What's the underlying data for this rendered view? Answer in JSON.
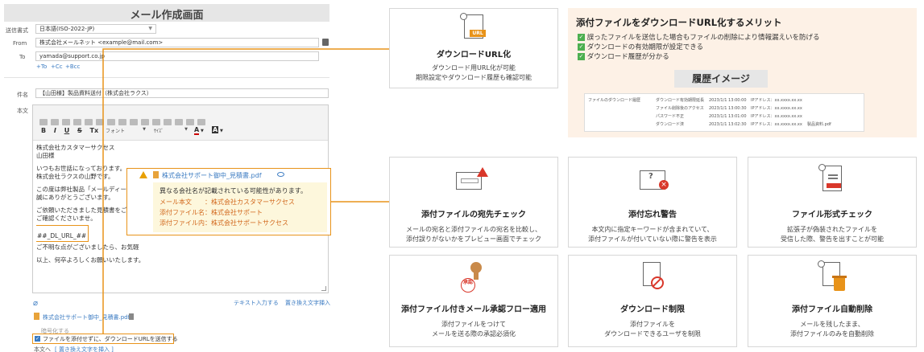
{
  "compose": {
    "title": "メール作成画面",
    "fields": {
      "encoding_label": "送信書式",
      "encoding_value": "日本語(ISO-2022-JP)",
      "from_label": "From",
      "from_value": "株式会社メールネット <example@mail.com>",
      "to_label": "To",
      "to_value": "yamada@support.co.jp",
      "to_links": [
        "+To",
        "+Cc",
        "+Bcc"
      ],
      "subject_label": "件名",
      "subject_value": "【山田様】製品資料送付（株式会社ラクス）",
      "body_label": "本文"
    },
    "toolbar": {
      "font_label": "フォント",
      "size_label": "ｻｲｽﾞ",
      "format_buttons": [
        "B",
        "I",
        "U",
        "S",
        "Tx"
      ],
      "color_a": "A",
      "color_b": "A"
    },
    "body_lines": [
      "株式会社カスタマーサクセス",
      "山田様",
      "",
      "いつもお世話になっております。",
      "株式会社ラクスの山野です。",
      "",
      "この度は弊社製品「メールディーラー",
      "誠にありがとうございます。",
      "",
      "ご依頼いただきました見積書をご案",
      "ご確認くださいませ。"
    ],
    "placeholder_tag": "##_DL_URL_##",
    "body_lines_after": [
      "ご不明な点がございましたら、お気軽",
      "",
      "以上、何卒よろしくお願いいたします。"
    ],
    "footer_links": [
      "テキスト入力する",
      "置き換え文字挿入"
    ],
    "attachment_name": "株式会社サポート御中_見積書.pdf",
    "encrypt_label": "暗号化する",
    "checkbox_label": "ファイルを添付せずに、ダウンロードURLを送信する",
    "insert_prefix": "本文へ",
    "insert_link": "[ 置き換え文字を挿入 ]"
  },
  "warning_popup": {
    "filename": "株式会社サポート御中_見積書.pdf",
    "message": "異なる会社名が記載されている可能性があります。",
    "rows": [
      {
        "key": "メール本文",
        "value": "：株式会社カスタマーサクセス"
      },
      {
        "key": "添付ファイル名",
        "value": "：株式会社サポート"
      },
      {
        "key": "添付ファイル内",
        "value": "：株式会社サポートサクセス"
      }
    ]
  },
  "features": {
    "download_url": {
      "title": "ダウンロードURL化",
      "desc": [
        "ダウンロード用URL化が可能",
        "期限設定やダウンロード履歴も確認可能"
      ],
      "icon_badge": "URL"
    },
    "merits": {
      "title": "添付ファイルをダウンロードURL化するメリット",
      "items": [
        "誤ったファイルを送信した場合もファイルの削除により情報漏えいを防げる",
        "ダウンロードの有効期限が設定できる",
        "ダウンロード履歴が分かる"
      ],
      "history_label": "履歴イメージ",
      "history_table_title": "ファイルのダウンロード履歴",
      "history_rows": [
        [
          "ダウンロード有効期限延長",
          "2023/1/1 13:00:00",
          "IPアドレス：xx.xxxx.xx.xx",
          ""
        ],
        [
          "ファイル削除後のアクセス",
          "2023/1/1 13:00:30",
          "IPアドレス：xx.xxxx.xx.xx",
          ""
        ],
        [
          "パスワード不正",
          "2023/1/1 13:01:00",
          "IPアドレス：xx.xxxx.xx.xx",
          ""
        ],
        [
          "ダウンロード済",
          "2023/1/1 13:02:30",
          "IPアドレス：xx.xxxx.xx.xx",
          "製品資料.pdf"
        ]
      ]
    },
    "cards": [
      {
        "title": "添付ファイルの宛先チェック",
        "desc": [
          "メールの宛名と添付ファイルの宛名を比較し、",
          "添付誤りがないかをプレビュー画面でチェック"
        ],
        "icon": "mail-warning-icon"
      },
      {
        "title": "添付忘れ警告",
        "desc": [
          "本文内に指定キーワードが含まれていて、",
          "添付ファイルが付いていない際に警告を表示"
        ],
        "icon": "mail-question-icon"
      },
      {
        "title": "ファイル形式チェック",
        "desc": [
          "拡張子が偽装されたファイルを",
          "受信した際、警告を出すことが可能"
        ],
        "icon": "file-check-icon"
      },
      {
        "title": "添付ファイル付きメール承認フロー適用",
        "desc": [
          "添付ファイルをつけて",
          "メールを送る際の承認必須化"
        ],
        "icon": "approval-stamp-icon",
        "stamp_text": "承認"
      },
      {
        "title": "ダウンロード制限",
        "desc": [
          "添付ファイルを",
          "ダウンロードできるユーザを制限"
        ],
        "icon": "download-restrict-icon"
      },
      {
        "title": "添付ファイル自動削除",
        "desc": [
          "メールを残したまま、",
          "添付ファイルのみを自動削除"
        ],
        "icon": "auto-delete-icon"
      }
    ]
  },
  "colors": {
    "accent": "#e8931a",
    "merit_bg": "#fdf1e6",
    "title_bar": "#e6e6e6",
    "link": "#3b7bc2",
    "check_green": "#4caf50",
    "warning_red": "#d9372a",
    "popup_text": "#d2691e"
  }
}
